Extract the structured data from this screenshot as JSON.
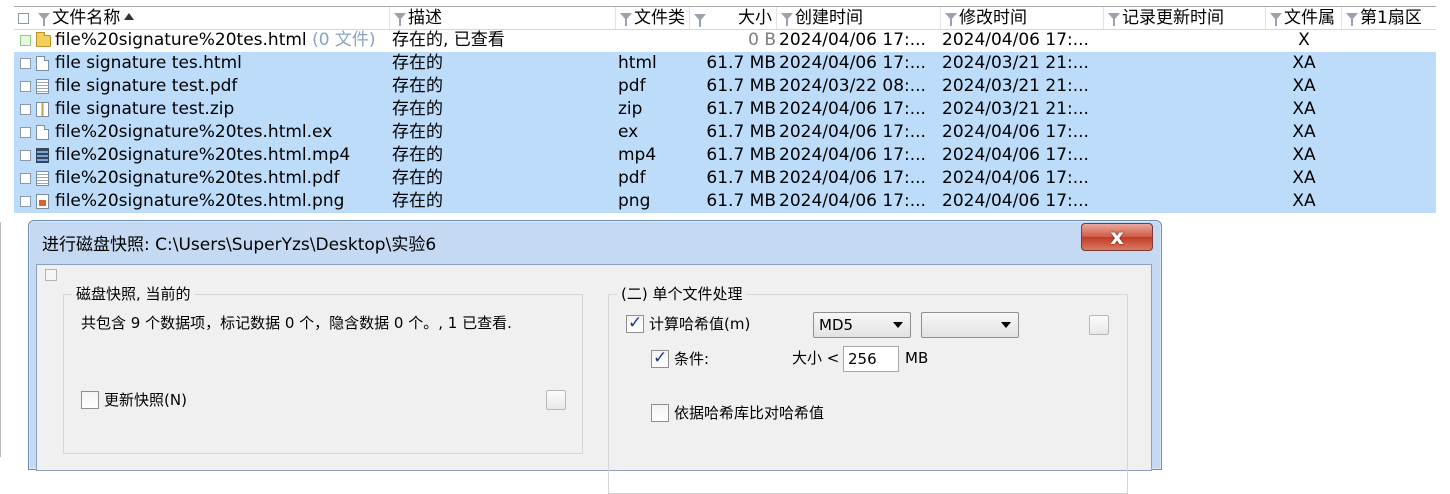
{
  "table": {
    "columns": {
      "name": "文件名称",
      "desc": "描述",
      "type": "文件类",
      "size": "大小",
      "created": "创建时间",
      "modified": "修改时间",
      "record_updated": "记录更新时间",
      "attr": "文件属",
      "sector": "第1扇区"
    },
    "rows": [
      {
        "name": "file%20signature%20tes.html",
        "extra": "(0 文件)",
        "desc": "存在的, 已查看",
        "type": "",
        "size": "0 B",
        "created": "2024/04/06  17:...",
        "modified": "2024/04/06  17:...",
        "record_updated": "",
        "attr": "X",
        "icon": "folder-icon",
        "selected": false
      },
      {
        "name": "file signature tes.html",
        "desc": "存在的",
        "type": "html",
        "size": "61.7 MB",
        "created": "2024/04/06  17:...",
        "modified": "2024/03/21  21:...",
        "record_updated": "",
        "attr": "XA",
        "icon": "html-file-icon",
        "selected": true
      },
      {
        "name": "file signature test.pdf",
        "desc": "存在的",
        "type": "pdf",
        "size": "61.7 MB",
        "created": "2024/03/22  08:...",
        "modified": "2024/03/21  21:...",
        "record_updated": "",
        "attr": "XA",
        "icon": "pdf-file-icon",
        "selected": true
      },
      {
        "name": "file signature test.zip",
        "desc": "存在的",
        "type": "zip",
        "size": "61.7 MB",
        "created": "2024/04/06  17:...",
        "modified": "2024/03/21  21:...",
        "record_updated": "",
        "attr": "XA",
        "icon": "zip-file-icon",
        "selected": true
      },
      {
        "name": "file%20signature%20tes.html.ex",
        "desc": "存在的",
        "type": "ex",
        "size": "61.7 MB",
        "created": "2024/04/06  17:...",
        "modified": "2024/04/06  17:...",
        "record_updated": "",
        "attr": "XA",
        "icon": "generic-file-icon",
        "selected": true
      },
      {
        "name": "file%20signature%20tes.html.mp4",
        "desc": "存在的",
        "type": "mp4",
        "size": "61.7 MB",
        "created": "2024/04/06  17:...",
        "modified": "2024/04/06  17:...",
        "record_updated": "",
        "attr": "XA",
        "icon": "video-file-icon",
        "selected": true
      },
      {
        "name": "file%20signature%20tes.html.pdf",
        "desc": "存在的",
        "type": "pdf",
        "size": "61.7 MB",
        "created": "2024/04/06  17:...",
        "modified": "2024/04/06  17:...",
        "record_updated": "",
        "attr": "XA",
        "icon": "pdf-file-icon",
        "selected": true
      },
      {
        "name": "file%20signature%20tes.html.png",
        "desc": "存在的",
        "type": "png",
        "size": "61.7 MB",
        "created": "2024/04/06  17:...",
        "modified": "2024/04/06  17:...",
        "record_updated": "",
        "attr": "XA",
        "icon": "image-file-icon",
        "selected": true
      }
    ]
  },
  "dialog": {
    "title": "进行磁盘快照: C:\\Users\\SuperYzs\\Desktop\\实验6",
    "close_label": "x",
    "snapshot_group": {
      "legend": "磁盘快照, 当前的",
      "summary": "共包含 9 个数据项，标记数据 0 个，隐含数据 0 个。, 1 已查看.",
      "update_label": "更新快照(N)",
      "update_checked": false
    },
    "single_file_group": {
      "legend": "(二) 单个文件处理",
      "hash_label": "计算哈希值(m)",
      "hash_checked": true,
      "hash_algo": "MD5",
      "hash_algo2": "",
      "condition_label": "条件:",
      "condition_checked": true,
      "size_label": "大小 <",
      "size_value": "256",
      "size_unit": "MB",
      "compare_label": "依据哈希库比对哈希值",
      "compare_checked": false
    }
  },
  "colors": {
    "selection": "#bcdcf9",
    "dialog_frame": "#c5daf2",
    "close_button": "#c23c26"
  }
}
